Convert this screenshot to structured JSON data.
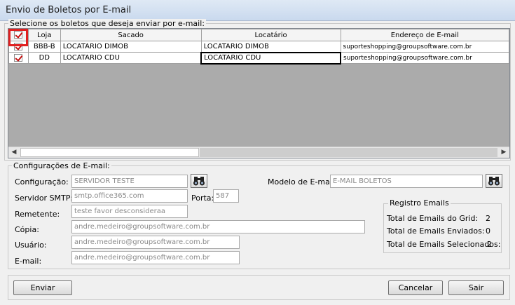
{
  "window": {
    "title": "Envio de Boletos por E-mail"
  },
  "boletos_group": {
    "legend": "Selecione os boletos que deseja enviar por e-mail:"
  },
  "grid": {
    "columns": {
      "loja": "Loja",
      "sacado": "Sacado",
      "locatario": "Locatário",
      "email": "Endereço de E-mail"
    },
    "rows": [
      {
        "checked": true,
        "loja": "BBB-B",
        "sacado": "LOCATARIO DIMOB",
        "locatario": "LOCATARIO DIMOB",
        "email": "suporteshopping@groupsoftware.com.br"
      },
      {
        "checked": true,
        "loja": "DD",
        "sacado": "LOCATARIO CDU",
        "locatario": "LOCATARIO CDU",
        "email": "suporteshopping@groupsoftware.com.br"
      }
    ]
  },
  "config": {
    "legend": "Configurações de E-mail:",
    "configuracao": {
      "label": "Configuração:",
      "value": "SERVIDOR TESTE"
    },
    "modelo": {
      "label": "Modelo de E-mail:",
      "value": "E-MAIL BOLETOS"
    },
    "smtp": {
      "label": "Servidor SMTP:",
      "value": "smtp.office365.com"
    },
    "porta": {
      "label": "Porta:",
      "value": "587"
    },
    "remetente": {
      "label": "Remetente:",
      "value": "teste favor desconsideraa"
    },
    "copia": {
      "label": "Cópia:",
      "value": "andre.medeiro@groupsoftware.com.br"
    },
    "usuario": {
      "label": "Usuário:",
      "value": "andre.medeiro@groupsoftware.com.br"
    },
    "email": {
      "label": "E-mail:",
      "value": "andre.medeiro@groupsoftware.com.br"
    }
  },
  "registro": {
    "legend": "Registro Emails",
    "grid_label": "Total de Emails do Grid:",
    "grid_value": "2",
    "enviados_label": "Total de Emails Enviados:",
    "enviados_value": "0",
    "selecionados_label": "Total de Emails Selecionados:",
    "selecionados_value": "2"
  },
  "buttons": {
    "enviar": "Enviar",
    "cancelar": "Cancelar",
    "sair": "Sair"
  }
}
